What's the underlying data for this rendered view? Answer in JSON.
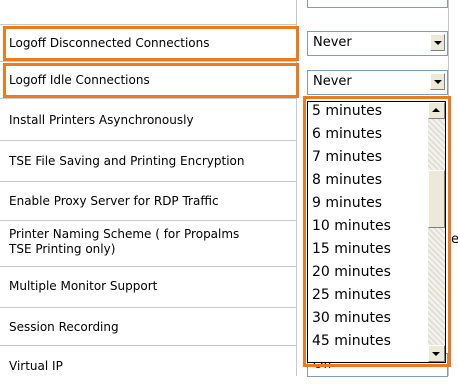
{
  "settings": {
    "rows": [
      {
        "label": "Logoff Disconnected Connections"
      },
      {
        "label": "Logoff Idle Connections"
      },
      {
        "label": "Install Printers Asynchronously"
      },
      {
        "label": "TSE File Saving and Printing Encryption"
      },
      {
        "label": "Enable Proxy Server for RDP Traffic"
      },
      {
        "label": "Printer Naming Scheme ( for Propalms",
        "label2": "TSE Printing only)"
      },
      {
        "label": "Multiple Monitor Support"
      },
      {
        "label": "Session Recording"
      },
      {
        "label": "Virtual IP"
      }
    ]
  },
  "controls": {
    "logoff_disconnected_value": "Never",
    "logoff_idle_value": "Never",
    "virtual_ip_value": "Off",
    "partial_cell_text": "e"
  },
  "dropdown": {
    "options": [
      "5 minutes",
      "6 minutes",
      "7 minutes",
      "8 minutes",
      "9 minutes",
      "10 minutes",
      "15 minutes",
      "20 minutes",
      "25 minutes",
      "30 minutes",
      "45 minutes"
    ]
  },
  "colors": {
    "highlight": "#f07a1b",
    "grid": "#c8c8c8",
    "control_border": "#7f9db9"
  }
}
